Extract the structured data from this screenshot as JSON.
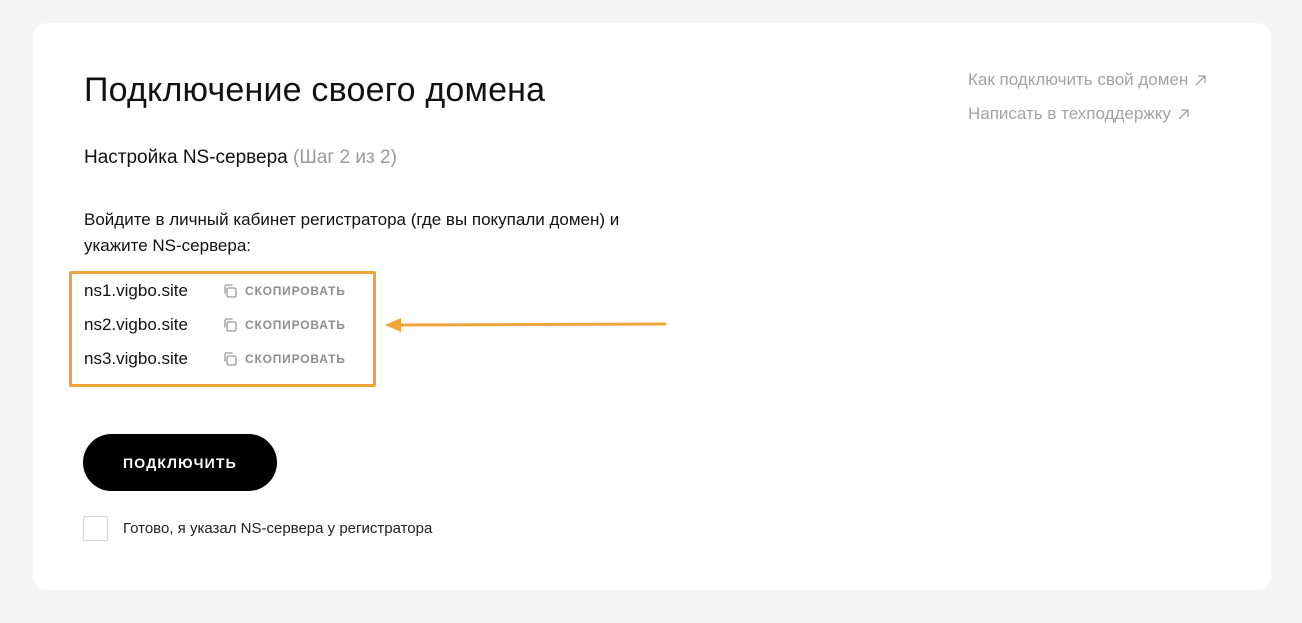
{
  "page": {
    "title": "Подключение своего домена",
    "step_label": "Настройка NS-сервера",
    "step_count": "(Шаг 2 из 2)",
    "intro_line1": "Войдите в личный кабинет регистратора (где вы покупали домен) и",
    "intro_line2": "укажите NS-сервера:"
  },
  "ns_servers": [
    {
      "name": "ns1.vigbo.site",
      "copy_label": "СКОПИРОВАТЬ"
    },
    {
      "name": "ns2.vigbo.site",
      "copy_label": "СКОПИРОВАТЬ"
    },
    {
      "name": "ns3.vigbo.site",
      "copy_label": "СКОПИРОВАТЬ"
    }
  ],
  "actions": {
    "connect_label": "ПОДКЛЮЧИТЬ",
    "confirm_checkbox_label": "Готово, я указал NS-сервера у регистратора",
    "confirm_checked": false
  },
  "links": {
    "how_to_connect": "Как подключить свой домен",
    "contact_support": "Написать в техподдержку"
  },
  "colors": {
    "highlight": "#f0a53a",
    "button_bg": "#000000",
    "muted_text": "#9a9a9a"
  },
  "icons": {
    "copy": "copy-icon",
    "external": "arrow-up-right-icon"
  }
}
